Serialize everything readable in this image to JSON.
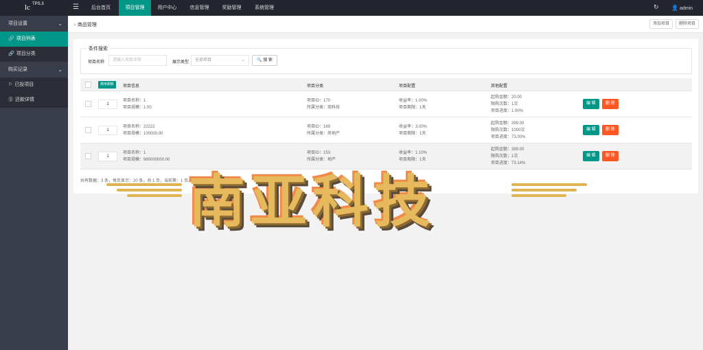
{
  "app": {
    "logo": "lc",
    "logo_sup": "TPS.3"
  },
  "topnav": [
    {
      "label": "后台首页",
      "active": false
    },
    {
      "label": "项目管理",
      "active": true
    },
    {
      "label": "用户中心",
      "active": false
    },
    {
      "label": "信息管理",
      "active": false
    },
    {
      "label": "奖励管理",
      "active": false
    },
    {
      "label": "系统管理",
      "active": false
    }
  ],
  "user": {
    "name": "admin"
  },
  "sidebar": {
    "group1": "项目设置",
    "items1": [
      {
        "label": "项目列表",
        "active": true
      },
      {
        "label": "项目分类",
        "active": false
      }
    ],
    "group2": "购买记录",
    "items2": [
      {
        "label": "已投项目",
        "active": false
      },
      {
        "label": "还款详情",
        "active": false
      }
    ]
  },
  "breadcrumb": {
    "title": "商品管理",
    "add_btn": "添加项目",
    "delete_btn": "删除项目"
  },
  "filter": {
    "legend": "条件搜索",
    "name_label": "项目名称",
    "name_placeholder": "请输入项目名称",
    "type_label": "展示类型",
    "type_value": "全部项目",
    "search_btn": "搜 索"
  },
  "table": {
    "sort_btn": "排序刷新",
    "headers": [
      "项目信息",
      "项目分类",
      "项目配置",
      "其他配置"
    ],
    "rows": [
      {
        "sort": "1",
        "name": "项目名称：1",
        "scale": "项目规模：1.00",
        "pid": "项目ID：170",
        "cat": "所属分类：商科技",
        "rate": "收益率：1.00%",
        "period": "项目期限：1天",
        "min": "起购金额：20.00",
        "limit": "限购次数：1次",
        "progress": "项目进度：1.00%"
      },
      {
        "sort": "1",
        "name": "项目名称：22222",
        "scale": "项目规模：100000.00",
        "pid": "项目ID：169",
        "cat": "所属分类：房地产",
        "rate": "收益率：3.00%",
        "period": "项目期限：1天",
        "min": "起购金额：399.00",
        "limit": "限购次数：1000次",
        "progress": "项目进度：73.00%"
      },
      {
        "sort": "1",
        "name": "项目名称：1",
        "scale": "项目规模：980000000.00",
        "pid": "项目ID：153",
        "cat": "所属分类：地产",
        "rate": "收益率：1.10%",
        "period": "项目期限：1天",
        "min": "起购金额：399.00",
        "limit": "限购次数：1次",
        "progress": "项目进度：73.14%"
      }
    ],
    "edit_label": "编 辑",
    "delete_label": "删 除",
    "footer": "共有数据：3 条，每页显示：20 条，共 1 页，当前第：1 页。"
  },
  "watermark": "南亚科技",
  "colors": {
    "accent": "#009688",
    "danger": "#ff5722",
    "topbar": "#23262e",
    "sidebar": "#393d49"
  }
}
